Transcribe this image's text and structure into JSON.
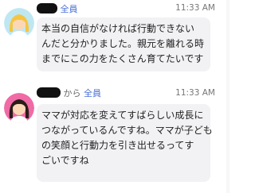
{
  "messages": [
    {
      "sender_redacted": true,
      "recipient": "全員",
      "time": "11:33 AM",
      "lines": [
        "本当の自信がなければ行動できない",
        "んだと分かりました。親元を離れる時",
        "までにこの力をたくさん育てたいです"
      ]
    },
    {
      "sender_redacted": true,
      "from_word": "から",
      "recipient": "全員",
      "time": "11:33 AM",
      "lines": [
        "ママが対応を変えてすばらしい成長に",
        "つながっているんですね。ママが子ども",
        "の笑顔と行動力を引き出せるってす",
        "ごいですね"
      ]
    }
  ],
  "colors": {
    "bubble": "#f2f2f5",
    "recipient": "#4a6fd6",
    "avatar1_bg": "#bfe7f2",
    "avatar2_bg": "#f06aa6"
  },
  "icons": [
    "avatar-blonde-woman",
    "avatar-darkhair-woman"
  ]
}
